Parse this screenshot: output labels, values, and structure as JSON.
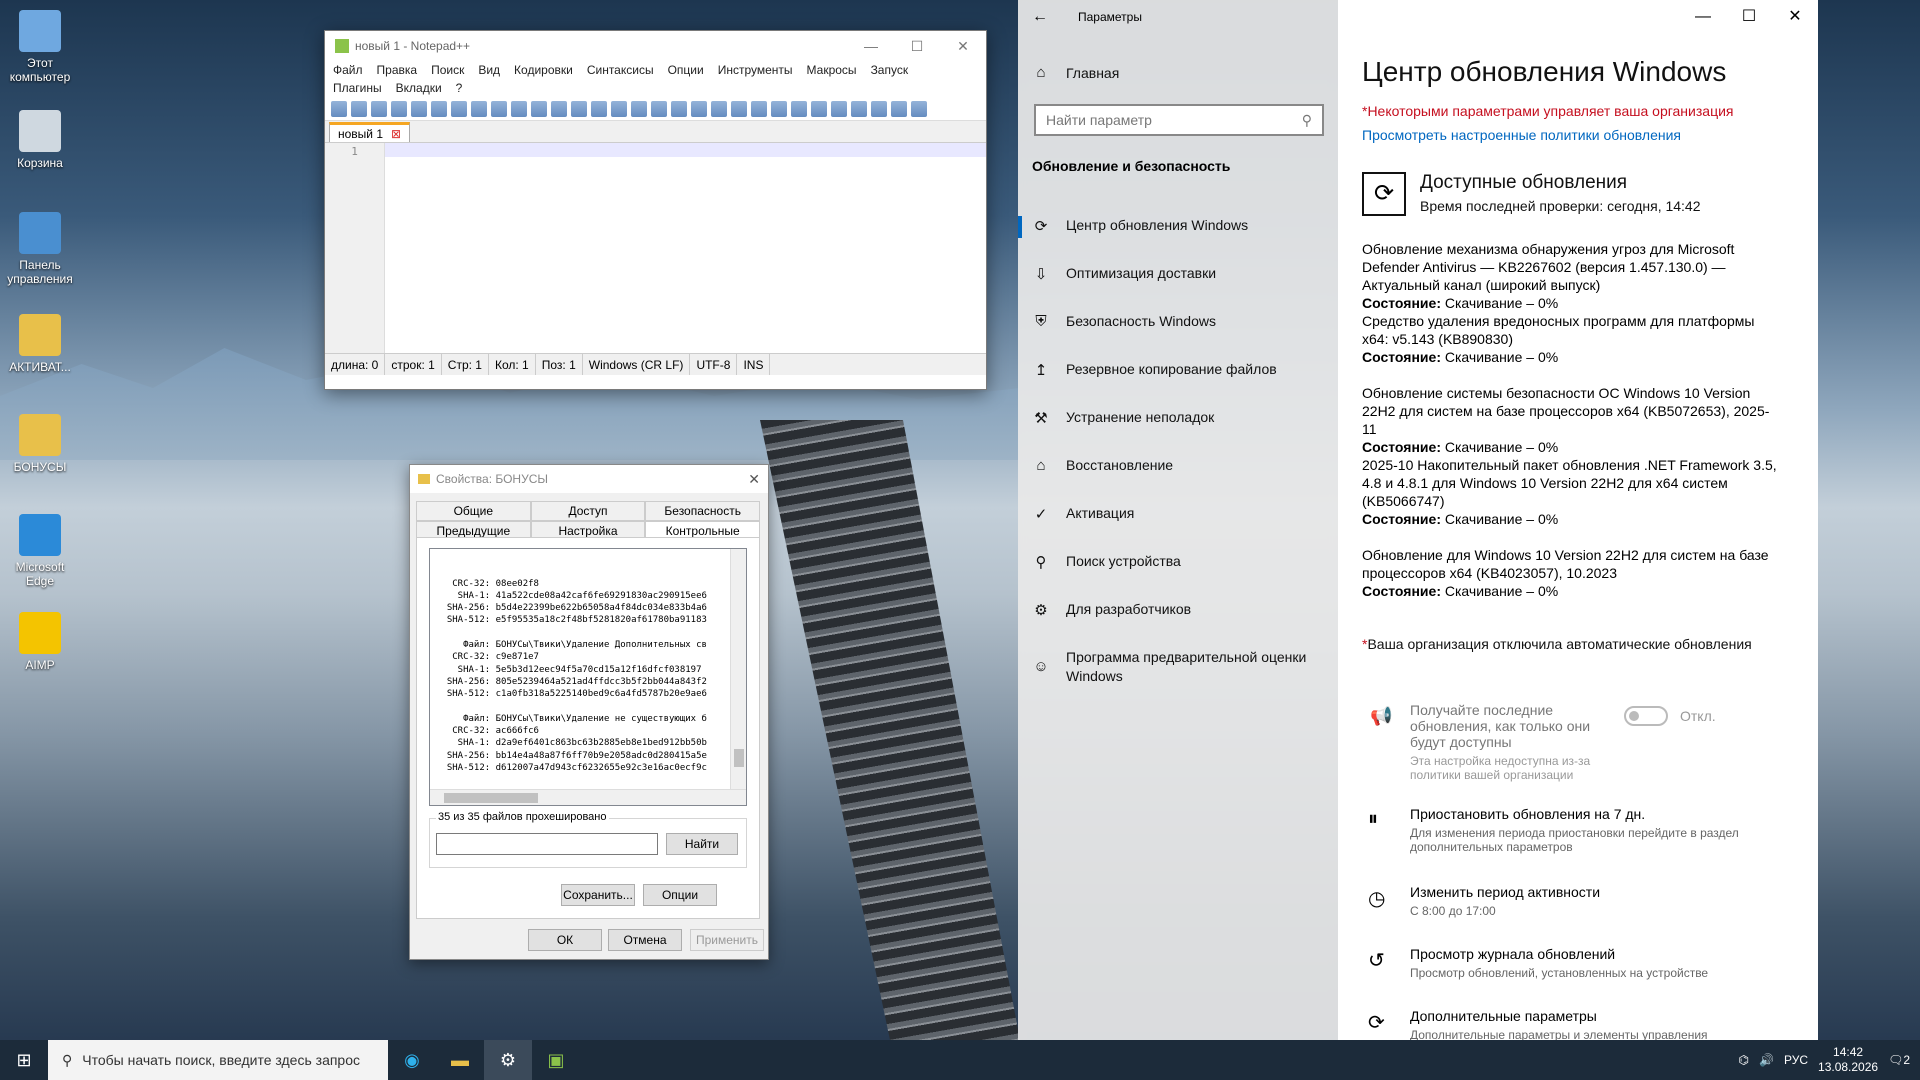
{
  "desktop": {
    "icons": [
      {
        "label": "Этот компьютер",
        "color": "#6fa8e0"
      },
      {
        "label": "Корзина",
        "color": "#cfd8e0"
      },
      {
        "label": "Панель управления",
        "color": "#4a8fd0"
      },
      {
        "label": "АКТИВАТ...",
        "color": "#e8c04a"
      },
      {
        "label": "БОНУСЫ",
        "color": "#e8c04a"
      },
      {
        "label": "Microsoft Edge",
        "color": "#2b8ad8"
      },
      {
        "label": "AIMP",
        "color": "#f4c400"
      }
    ]
  },
  "notepad": {
    "title": "новый 1 - Notepad++",
    "menu": [
      "Файл",
      "Правка",
      "Поиск",
      "Вид",
      "Кодировки",
      "Синтаксисы",
      "Опции",
      "Инструменты",
      "Макросы",
      "Запуск"
    ],
    "menu2": [
      "Плагины",
      "Вкладки",
      "?"
    ],
    "tab": "новый 1",
    "line": "1",
    "status": [
      "длина: 0",
      "строк: 1",
      "Стр: 1",
      "Кол: 1",
      "Поз: 1",
      "Windows (CR LF)",
      "UTF-8",
      "INS"
    ]
  },
  "props": {
    "title": "Свойства: БОНУСЫ",
    "tabs_row1": [
      "Общие",
      "Доступ",
      "Безопасность"
    ],
    "tabs_row2": [
      "Предыдущие версии",
      "Настройка",
      "Контрольные суммы"
    ],
    "hash_lines": [
      "   CRC-32: 08ee02f8",
      "    SHA-1: 41a522cde08a42caf6fe69291830ac290915ee6",
      "  SHA-256: b5d4e22399be622b65058a4f84dc034e833b4a6",
      "  SHA-512: e5f95535a18c2f48bf5281820af61780ba91183",
      "",
      "     Файл: БОНУСы\\Твики\\Удаление Дополнительных св",
      "   CRC-32: c9e871e7",
      "    SHA-1: 5e5b3d12eec94f5a70cd15a12f16dfcf038197",
      "  SHA-256: 805e5239464a521ad4ffdcc3b5f2bb044a843f2",
      "  SHA-512: c1a0fb318a5225140bed9c6a4fd5787b20e9ae6",
      "",
      "     Файл: БОНУСы\\Твики\\Удаление не существующих б",
      "   CRC-32: ac666fc6",
      "    SHA-1: d2a9ef6401c863bc63b2885eb8e1bed912bb50b",
      "  SHA-256: bb14e4a48a87f6ff70b9e2058adc0d280415a5e",
      "  SHA-512: d612007a47d943cf6232655e92c3e16ac0ecf9c"
    ],
    "progress": "35 из 35 файлов прохешировано",
    "find": "Найти",
    "save": "Сохранить...",
    "options": "Опции",
    "ok": "ОК",
    "cancel": "Отмена",
    "apply": "Применить"
  },
  "settings": {
    "window_title": "Параметры",
    "home": "Главная",
    "search_placeholder": "Найти параметр",
    "section": "Обновление и безопасность",
    "nav": [
      {
        "label": "Центр обновления Windows",
        "icon": "⟳"
      },
      {
        "label": "Оптимизация доставки",
        "icon": "⇩"
      },
      {
        "label": "Безопасность Windows",
        "icon": "⛨"
      },
      {
        "label": "Резервное копирование файлов",
        "icon": "↥"
      },
      {
        "label": "Устранение неполадок",
        "icon": "⚒"
      },
      {
        "label": "Восстановление",
        "icon": "⌂"
      },
      {
        "label": "Активация",
        "icon": "✓"
      },
      {
        "label": "Поиск устройства",
        "icon": "⚲"
      },
      {
        "label": "Для разработчиков",
        "icon": "⚙"
      },
      {
        "label": "Программа предварительной оценки Windows",
        "icon": "☺"
      }
    ],
    "page_title": "Центр обновления Windows",
    "managed_note": "*Некоторыми параметрами управляет ваша организация",
    "policy_link": "Просмотреть настроенные политики обновления",
    "available_title": "Доступные обновления",
    "last_check": "Время последней проверки: сегодня, 14:42",
    "state_label": "Состояние:",
    "updates": [
      {
        "name": "Обновление механизма обнаружения угроз для Microsoft Defender Antivirus — KB2267602 (версия 1.457.130.0) — Актуальный канал (широкий выпуск)",
        "state": "Скачивание – 0%"
      },
      {
        "name": "Средство удаления вредоносных программ для платформы x64: v5.143 (KB890830)",
        "state": "Скачивание – 0%"
      },
      {
        "name": "Обновление системы безопасности ОС Windows 10 Version 22H2 для систем на базе процессоров x64 (KB5072653), 2025-11",
        "state": "Скачивание – 0%"
      },
      {
        "name": "2025-10 Накопительный пакет обновления .NET Framework 3.5, 4.8 и 4.8.1 для Windows 10 Version 22H2 для x64 систем (KB5066747)",
        "state": "Скачивание – 0%"
      },
      {
        "name": "Обновление для Windows 10 Version 22H2 для систем на базе процессоров x64 (KB4023057), 10.2023",
        "state": "Скачивание – 0%"
      }
    ],
    "auto_disabled": "*Ваша организация отключила автоматические обновления",
    "latest_title": "Получайте последние обновления, как только они будут доступны",
    "latest_sub": "Эта настройка недоступна из-за политики вашей организации",
    "toggle_label": "Откл.",
    "options": [
      {
        "title": "Приостановить обновления на 7 дн.",
        "sub": "Для изменения периода приостановки перейдите в раздел дополнительных параметров",
        "icon": "⏸"
      },
      {
        "title": "Изменить период активности",
        "sub": "С 8:00 до 17:00",
        "icon": "◷"
      },
      {
        "title": "Просмотр журнала обновлений",
        "sub": "Просмотр обновлений, установленных на устройстве",
        "icon": "↺"
      },
      {
        "title": "Дополнительные параметры",
        "sub": "Дополнительные параметры и элементы управления",
        "icon": "⟳"
      }
    ]
  },
  "taskbar": {
    "search": "Чтобы начать поиск, введите здесь запрос",
    "lang": "РУС",
    "time": "14:42",
    "date": "13.08.2026",
    "notif": "2"
  }
}
